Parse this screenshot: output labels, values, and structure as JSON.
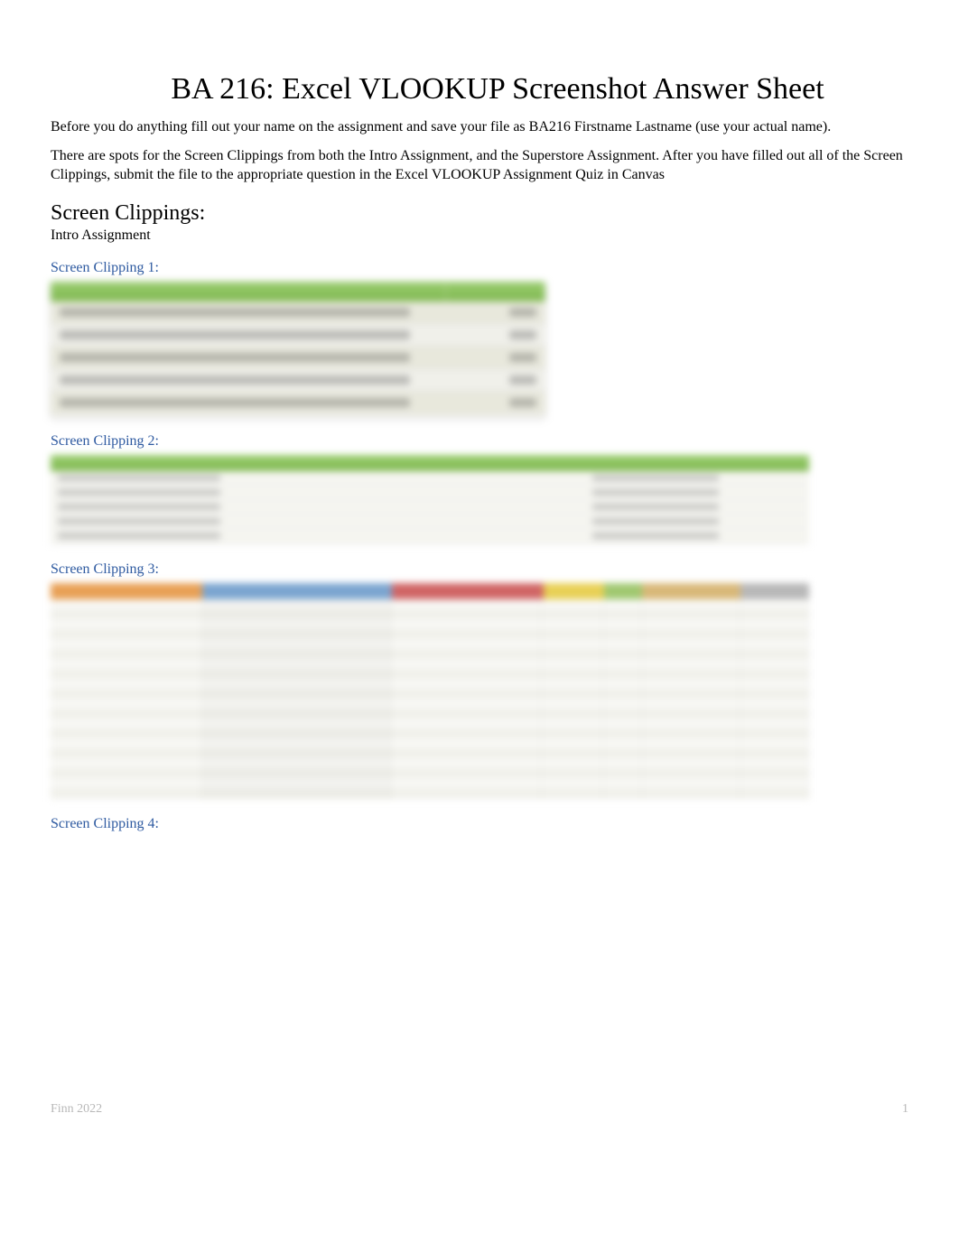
{
  "title": "BA 216: Excel VLOOKUP Screenshot Answer Sheet",
  "intro": {
    "para1": "Before you do anything fill out your name on the assignment and save your file as BA216 Firstname Lastname  (use your actual name).",
    "para2": "There are spots for the Screen Clippings from both the Intro Assignment, and the Superstore Assignment. After you have filled out all of the Screen Clippings, submit the file to the appropriate question in the Excel VLOOKUP Assignment Quiz in Canvas"
  },
  "section": {
    "heading": "Screen Clippings:",
    "sub": "Intro Assignment"
  },
  "clips": {
    "c1": "Screen Clipping 1:",
    "c2": "Screen Clipping 2:",
    "c3": "Screen Clipping 3:",
    "c4": "Screen Clipping 4:"
  },
  "footer": {
    "left": "Finn 2022",
    "right": "1"
  }
}
